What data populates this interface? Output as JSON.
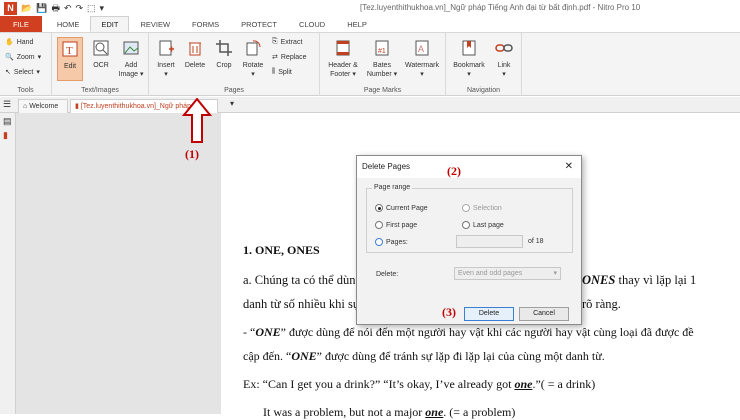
{
  "window": {
    "title": "[Tez.luyenthithukhoa.vn]_Ngữ pháp Tiếng Anh đại từ bất định.pdf - Nitro Pro 10"
  },
  "ribbon_tabs": [
    {
      "label": "FILE"
    },
    {
      "label": "HOME"
    },
    {
      "label": "EDIT"
    },
    {
      "label": "REVIEW"
    },
    {
      "label": "FORMS"
    },
    {
      "label": "PROTECT"
    },
    {
      "label": "CLOUD"
    },
    {
      "label": "HELP"
    }
  ],
  "tools": {
    "hand": "Hand",
    "zoom": "Zoom",
    "select": "Select",
    "group": "Tools"
  },
  "text_images": {
    "edit": "Edit",
    "ocr": "OCR",
    "add_image_1": "Add",
    "add_image_2": "Image",
    "group": "Text/Images"
  },
  "pages": {
    "insert": "Insert",
    "delete": "Delete",
    "crop": "Crop",
    "rotate": "Rotate",
    "extract": "Extract",
    "replace": "Replace",
    "split": "Split",
    "group": "Pages"
  },
  "page_marks": {
    "header_1": "Header &",
    "header_2": "Footer",
    "bates_1": "Bates",
    "bates_2": "Number",
    "watermark": "Watermark",
    "group": "Page Marks"
  },
  "navigation": {
    "bookmark": "Bookmark",
    "link": "Link",
    "group": "Navigation"
  },
  "doc_tabs": {
    "welcome": "Welcome",
    "document": "[Tez.luyenthithukhoa.vn]_Ngữ pháp..."
  },
  "annotations": {
    "a1": "(1)",
    "a2": "(2)",
    "a3": "(3)"
  },
  "document": {
    "heading": "1. ONE, ONES",
    "line1": "a. Chúng ta có thể dùng",
    "line1_end": "ONES thay vì lặp lại 1",
    "line2": "danh từ số nhiều khi sự",
    "line2_end": "rõ ràng.",
    "line3": "- “ONE” được dùng để nói đến một người hay vật khi các người hay vật cùng loại đã được đề",
    "line4": "cập đến. “ONE” được dùng để tránh sự lặp đi lặp lại của cùng một danh từ.",
    "line5": "Ex: “Can I get you a drink?” “It’s okay, I’ve already got one.”( = a drink)",
    "line6": "It was a problem, but not a major one. (= a problem)"
  },
  "dialog": {
    "title": "Delete Pages",
    "range_legend": "Page range",
    "current_page": "Current Page",
    "selection": "Selection",
    "first_page": "First page",
    "last_page": "Last page",
    "pages": "Pages:",
    "of_total": "of 18",
    "delete_label": "Delete:",
    "delete_option": "Even and odd pages",
    "delete_button": "Delete",
    "cancel_button": "Cancel"
  },
  "colors": {
    "accent": "#d04020",
    "annotation": "#c00000"
  }
}
